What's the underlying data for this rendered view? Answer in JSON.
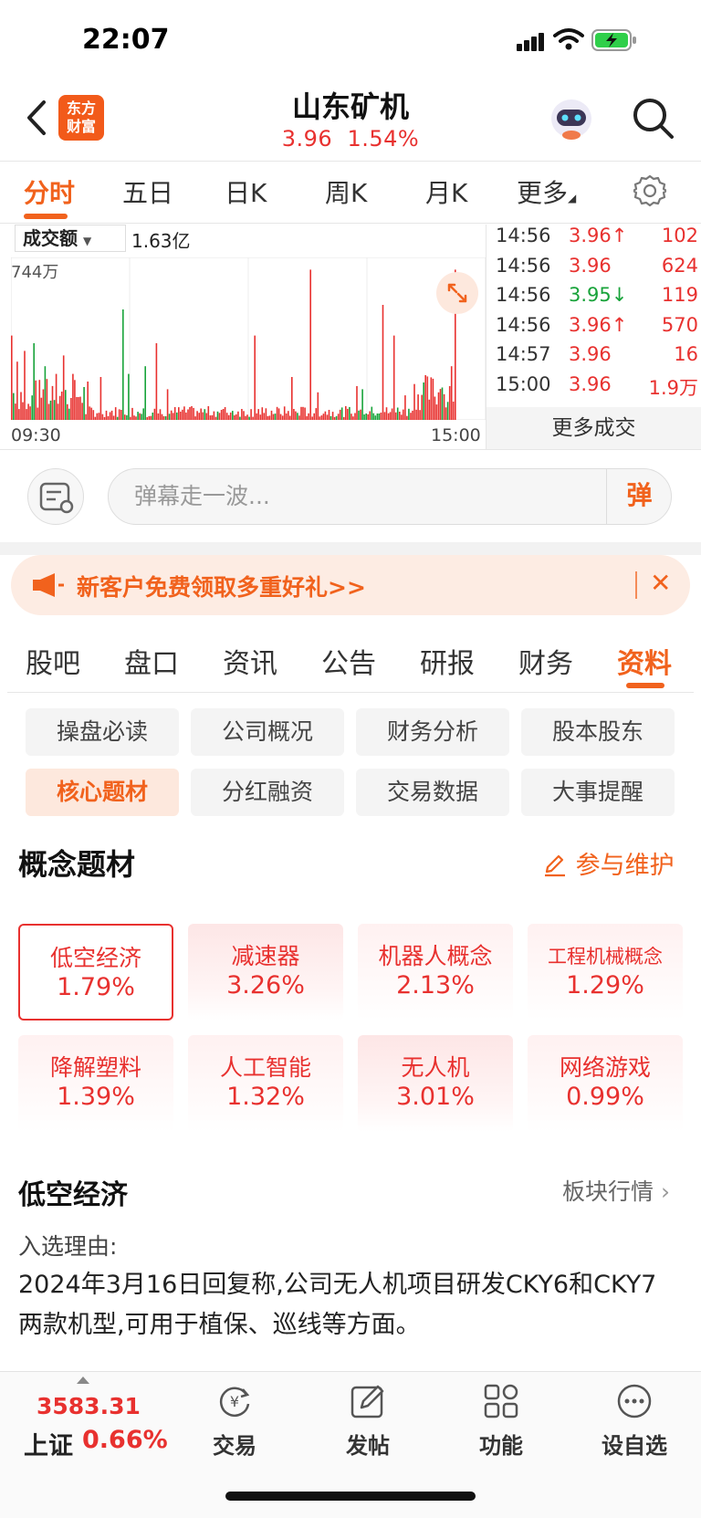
{
  "status": {
    "time": "22:07"
  },
  "header": {
    "title": "山东矿机",
    "price": "3.96",
    "change_pct": "1.54%",
    "logo_line1": "东方",
    "logo_line2": "财富"
  },
  "chart_tabs": [
    "分时",
    "五日",
    "日K",
    "周K",
    "月K",
    "更多"
  ],
  "volume_chart": {
    "selector_label": "成交额",
    "total": "1.63亿",
    "max_label": "744万",
    "time_start": "09:30",
    "time_end": "15:00"
  },
  "trades": [
    {
      "time": "14:56",
      "price": "3.96",
      "dir": "↑",
      "vol": "102",
      "color": "red"
    },
    {
      "time": "14:56",
      "price": "3.96",
      "dir": "",
      "vol": "624",
      "color": "red"
    },
    {
      "time": "14:56",
      "price": "3.95",
      "dir": "↓",
      "vol": "119",
      "color": "green"
    },
    {
      "time": "14:56",
      "price": "3.96",
      "dir": "↑",
      "vol": "570",
      "color": "red"
    },
    {
      "time": "14:57",
      "price": "3.96",
      "dir": "",
      "vol": "16",
      "color": "red"
    },
    {
      "time": "15:00",
      "price": "3.96",
      "dir": "",
      "vol": "1.9万",
      "color": "red"
    }
  ],
  "more_trades_label": "更多成交",
  "danmaku": {
    "placeholder": "弹幕走一波...",
    "send_label": "弹"
  },
  "promo": {
    "text": "新客户免费领取多重好礼>>"
  },
  "section_tabs": [
    "股吧",
    "盘口",
    "资讯",
    "公告",
    "研报",
    "财务",
    "资料"
  ],
  "sub_buttons": [
    "操盘必读",
    "公司概况",
    "财务分析",
    "股本股东",
    "核心题材",
    "分红融资",
    "交易数据",
    "大事提醒"
  ],
  "concepts_section": {
    "title": "概念题材",
    "maintain_label": "参与维护"
  },
  "concepts": [
    {
      "name": "低空经济",
      "pct": "1.79%"
    },
    {
      "name": "减速器",
      "pct": "3.26%"
    },
    {
      "name": "机器人概念",
      "pct": "2.13%"
    },
    {
      "name": "工程机械概念",
      "pct": "1.29%"
    },
    {
      "name": "降解塑料",
      "pct": "1.39%"
    },
    {
      "name": "人工智能",
      "pct": "1.32%"
    },
    {
      "name": "无人机",
      "pct": "3.01%"
    },
    {
      "name": "网络游戏",
      "pct": "0.99%"
    }
  ],
  "detail": {
    "title": "低空经济",
    "sector_link": "板块行情",
    "reason_label": "入选理由:",
    "reason_text": "2024年3月16日回复称,公司无人机项目研发CKY6和CKY7两款机型,可用于植保、巡线等方面。"
  },
  "bottom_bar": {
    "index_value": "3583.31",
    "index_name": "上证",
    "index_change": "0.66%",
    "nav": [
      "交易",
      "发帖",
      "功能",
      "设自选"
    ]
  },
  "colors": {
    "up": "#e8312f",
    "down": "#18a33a",
    "accent": "#f1621d"
  }
}
